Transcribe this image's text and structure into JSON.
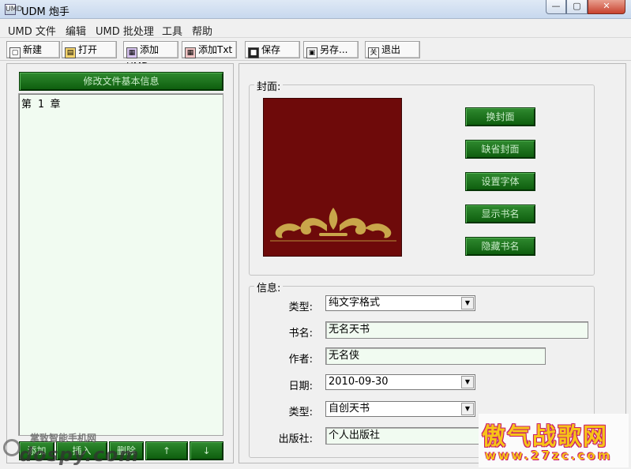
{
  "window": {
    "title": "UDM 炮手",
    "icon_glyph": "UMD",
    "min_glyph": "—",
    "max_glyph": "▢",
    "close_glyph": "✕"
  },
  "menu": [
    "UMD 文件",
    "编辑",
    "UMD 批处理",
    "工具",
    "帮助"
  ],
  "toolbar": [
    {
      "label": "新建",
      "icon": "new-file-icon",
      "glyph": "▢"
    },
    {
      "label": "打开",
      "icon": "open-folder-icon",
      "glyph": "▤"
    },
    {
      "label": "添加UMD",
      "icon": "add-umd-icon",
      "glyph": "▦"
    },
    {
      "label": "添加Txt",
      "icon": "add-txt-icon",
      "glyph": "▦"
    },
    {
      "label": "保存",
      "icon": "save-icon",
      "glyph": "■"
    },
    {
      "label": "另存...",
      "icon": "save-as-icon",
      "glyph": "▣"
    },
    {
      "label": "退出",
      "icon": "exit-icon",
      "glyph": "关"
    }
  ],
  "left": {
    "header": "修改文件基本信息",
    "chapters": [
      "第 1 章"
    ],
    "buttons": [
      {
        "label": "添加"
      },
      {
        "label": "插入"
      },
      {
        "label": "删除"
      },
      {
        "label": "↑"
      },
      {
        "label": "↓"
      }
    ]
  },
  "cover": {
    "group_label": "封面:",
    "buttons": [
      "换封面",
      "缺省封面",
      "设置字体",
      "显示书名",
      "隐藏书名"
    ]
  },
  "info": {
    "group_label": "信息:",
    "fields": [
      {
        "label": "类型:",
        "value": "纯文字格式",
        "kind": "select"
      },
      {
        "label": "书名:",
        "value": "无名天书",
        "kind": "input"
      },
      {
        "label": "作者:",
        "value": "无名侠",
        "kind": "input"
      },
      {
        "label": "日期:",
        "value": "2010-09-30",
        "kind": "select"
      },
      {
        "label": "类型:",
        "value": "自创天书",
        "kind": "select"
      },
      {
        "label": "出版社:",
        "value": "个人出版社",
        "kind": "input"
      }
    ]
  },
  "watermarks": {
    "left_line1": "掌致智能手机网",
    "left_line2": "dospy.com",
    "right_line1": "傲气战歌网",
    "right_line2": "www.27zc.com"
  },
  "colors": {
    "green_button": "#0d5c0d",
    "green_button_text": "#c9ecc9",
    "cover_background": "#6e0a0a",
    "cover_ornament": "#c9a64a",
    "input_background": "#f1fbf1"
  }
}
